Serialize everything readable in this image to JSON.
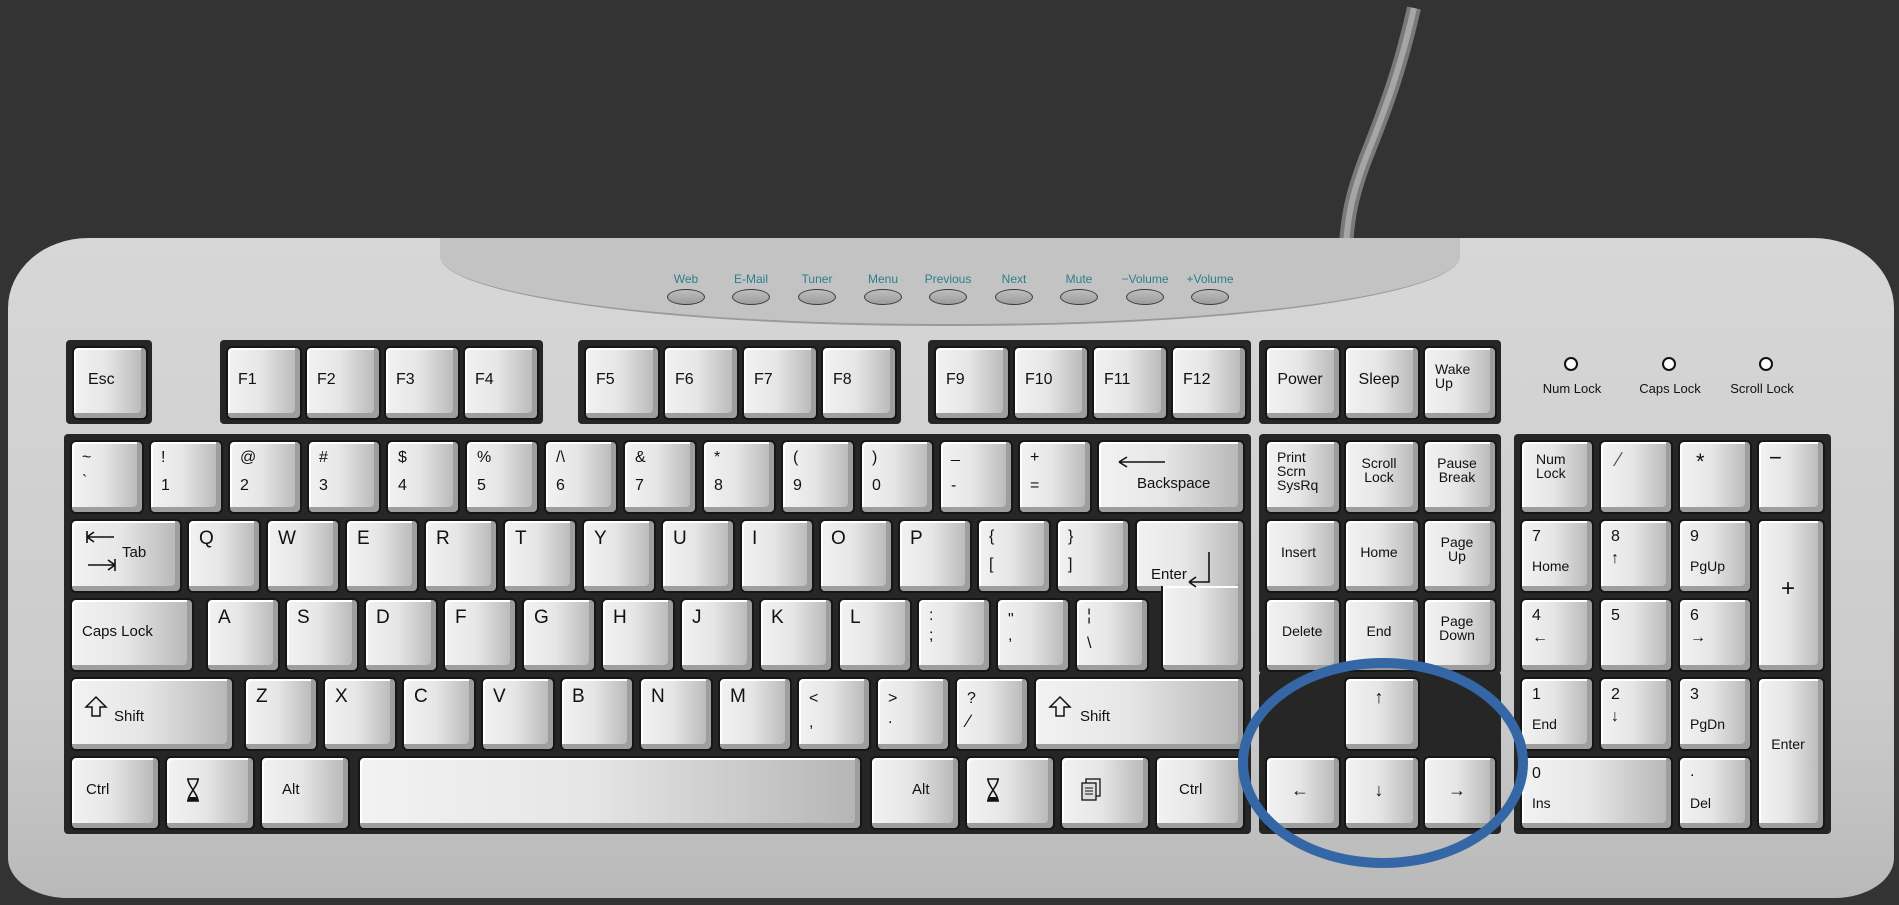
{
  "colors": {
    "background": "#333333",
    "keyboard_body": "#d0d0d0",
    "media_label": "#2d7e8e",
    "highlight_circle": "#3566a6"
  },
  "media_keys": [
    "Web",
    "E-Mail",
    "Tuner",
    "Menu",
    "Previous",
    "Next",
    "Mute",
    "−Volume",
    "+Volume"
  ],
  "indicators": [
    "Num Lock",
    "Caps Lock",
    "Scroll Lock"
  ],
  "keys": {
    "esc": "Esc",
    "f1": "F1",
    "f2": "F2",
    "f3": "F3",
    "f4": "F4",
    "f5": "F5",
    "f6": "F6",
    "f7": "F7",
    "f8": "F8",
    "f9": "F9",
    "f10": "F10",
    "f11": "F11",
    "f12": "F12",
    "power": "Power",
    "sleep": "Sleep",
    "wake_1": "Wake",
    "wake_2": "Up",
    "n1_top": "~",
    "n1_bot": "`",
    "n2_top": "!",
    "n2_bot": "1",
    "n3_top": "@",
    "n3_bot": "2",
    "n4_top": "#",
    "n4_bot": "3",
    "n5_top": "$",
    "n5_bot": "4",
    "n6_top": "%",
    "n6_bot": "5",
    "n7_top": "/\\",
    "n7_bot": "6",
    "n8_top": "&",
    "n8_bot": "7",
    "n9_top": "*",
    "n9_bot": "8",
    "n10_top": "(",
    "n10_bot": "9",
    "n11_top": ")",
    "n11_bot": "0",
    "n12_top": "_",
    "n12_bot": "-",
    "n13_top": "+",
    "n13_bot": "=",
    "backspace": "Backspace",
    "tab": "Tab",
    "q": "Q",
    "w": "W",
    "e": "E",
    "r": "R",
    "t": "T",
    "y": "Y",
    "u": "U",
    "i": "I",
    "o": "O",
    "p": "P",
    "lbrace_top": "{",
    "lbrace_bot": "[",
    "rbrace_top": "}",
    "rbrace_bot": "]",
    "enter": "Enter",
    "caps": "Caps Lock",
    "a": "A",
    "s": "S",
    "d": "D",
    "f": "F",
    "g": "G",
    "h": "H",
    "j": "J",
    "k": "K",
    "l": "L",
    "colon_top": ":",
    "colon_bot": ";",
    "quote_top": "\"",
    "quote_bot": ",",
    "pipe_top": "¦",
    "pipe_bot": "\\",
    "shift": "Shift",
    "z": "Z",
    "x": "X",
    "c": "C",
    "v": "V",
    "b": "B",
    "n": "N",
    "m": "M",
    "lt_top": "<",
    "lt_bot": ",",
    "gt_top": ">",
    "gt_bot": ".",
    "q_top": "?",
    "q_bot": "∕",
    "ctrl": "Ctrl",
    "alt": "Alt",
    "print_1": "Print",
    "print_2": "Scrn",
    "print_3": "SysRq",
    "scroll_1": "Scroll",
    "scroll_2": "Lock",
    "pause_1": "Pause",
    "pause_2": "Break",
    "insert": "Insert",
    "home": "Home",
    "pgup_1": "Page",
    "pgup_2": "Up",
    "delete": "Delete",
    "end": "End",
    "pgdn_1": "Page",
    "pgdn_2": "Down",
    "numlock_1": "Num",
    "numlock_2": "Lock",
    "np_div": "∕",
    "np_mul": "*",
    "np_minus": "−",
    "np_plus": "+",
    "np7_top": "7",
    "np7_bot": "Home",
    "np8_top": "8",
    "np8_bot": "↑",
    "np9_top": "9",
    "np9_bot": "PgUp",
    "np4_top": "4",
    "np4_bot": "←",
    "np5": "5",
    "np6_top": "6",
    "np6_bot": "→",
    "np1_top": "1",
    "np1_bot": "End",
    "np2_top": "2",
    "np2_bot": "↓",
    "np3_top": "3",
    "np3_bot": "PgDn",
    "np0_top": "0",
    "np0_bot": "Ins",
    "npdot_top": ".",
    "npdot_bot": "Del",
    "np_enter": "Enter",
    "arrow_up": "↑",
    "arrow_left": "←",
    "arrow_down": "↓",
    "arrow_right": "→"
  }
}
